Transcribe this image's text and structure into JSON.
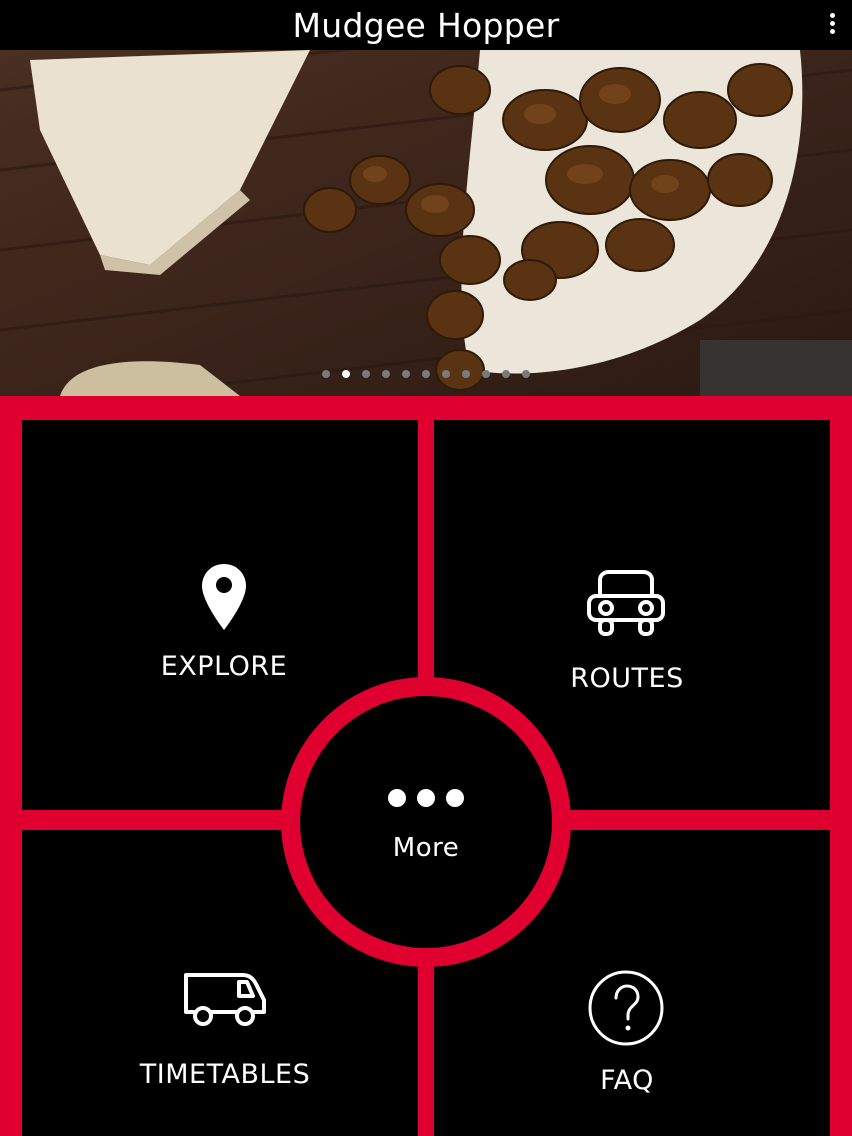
{
  "app": {
    "title": "Mudgee Hopper"
  },
  "hero": {
    "slide_count": 11,
    "active_index": 1
  },
  "menu": {
    "explore": "EXPLORE",
    "routes": "ROUTES",
    "more": "More",
    "timetables": "TIMETABLES",
    "faq": "FAQ"
  },
  "colors": {
    "accent": "#e0002f",
    "background": "#000000",
    "text": "#ffffff"
  },
  "icons": {
    "explore": "map-pin-icon",
    "routes": "car-icon",
    "more": "more-dots-icon",
    "timetables": "bus-icon",
    "faq": "question-circle-icon",
    "overflow": "overflow-menu-icon"
  }
}
